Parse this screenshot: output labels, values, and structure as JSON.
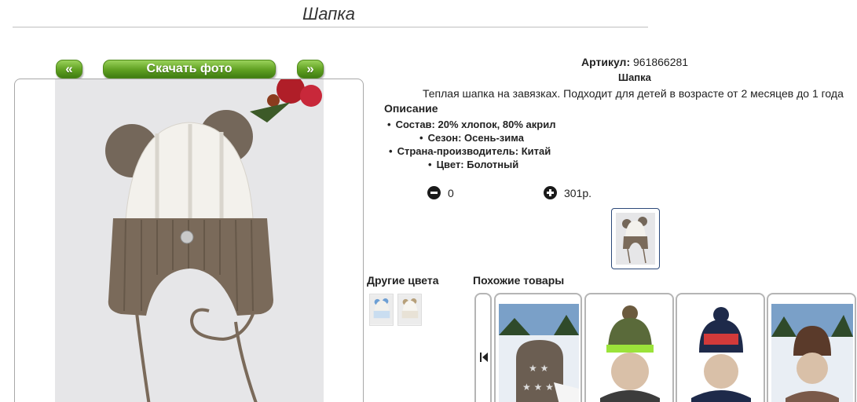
{
  "page": {
    "title": "Шапка"
  },
  "gallery": {
    "prev_label": "«",
    "download_label": "Скачать фото",
    "next_label": "»"
  },
  "product": {
    "article_label": "Артикул:",
    "article_value": "961866281",
    "name": "Шапка",
    "description": "Теплая шапка на завязках. Подходит для детей в возрасте от 2 месяцев до 1 года",
    "description_heading": "Описание",
    "specs": [
      "Состав: 20% хлопок, 80% акрил",
      "Сезон: Осень-зима",
      "Страна-производитель: Китай",
      "Цвет: Болотный"
    ],
    "quantity": "0",
    "price": "301р."
  },
  "colors": {
    "heading": "Другие цвета"
  },
  "similar": {
    "heading": "Похожие товары"
  },
  "palette": {
    "button_green": "#5fa021",
    "hat_brown": "#7a6a5a",
    "hat_white": "#f3f1ec"
  }
}
